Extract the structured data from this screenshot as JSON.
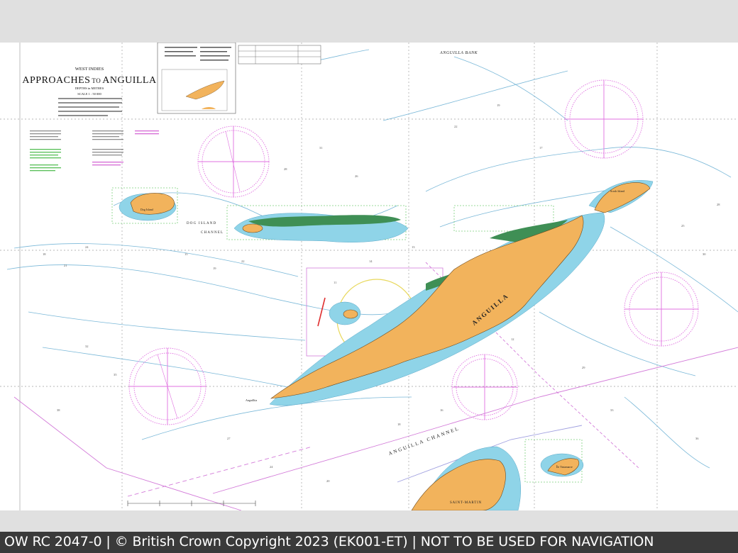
{
  "chart": {
    "region": "WEST INDIES",
    "title": "APPROACHES TO ANGUILLA",
    "title_main": "APPROACHES",
    "title_to": "TO",
    "title_place": "ANGUILLA",
    "depths_note": "DEPTHS in METRES",
    "scale": "SCALE 1 : 50 000"
  },
  "place_labels": {
    "anguilla_bank": "ANGUILLA BANK",
    "anguilla": "ANGUILLA",
    "dog_island": "DOG ISLAND",
    "channel": "CHANNEL",
    "dog_isl_short": "Dog Island",
    "scrub_island": "Scrub Island",
    "anguilla_channel": "ANGUILLA CHANNEL",
    "saint_martin": "SAINT-MARTIN",
    "ile_tintamarre": "Île Tintamarre",
    "anguillita": "Anguillita"
  },
  "footer": {
    "text": "OW RC 2047-0 | © British Crown Copyright 2023 (EK001-ET) | NOT TO BE USED FOR NAVIGATION"
  },
  "colors": {
    "land": "#f2b35c",
    "shoal": "#8fd4e8",
    "drying": "#3f8f55",
    "compass": "#e070e0",
    "route": "#d37bd9",
    "contour": "#7ab8d8",
    "grid": "#9a9a9a",
    "footer_bg": "#3a3a3a"
  }
}
